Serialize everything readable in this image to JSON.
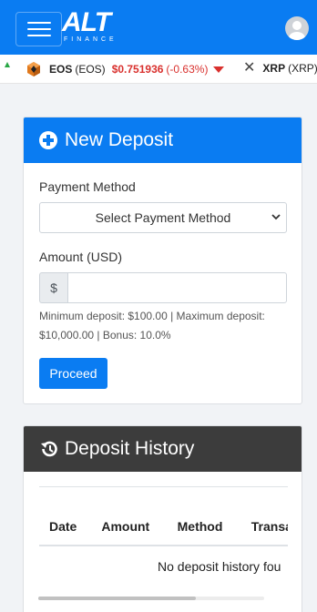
{
  "navbar": {
    "logo_text": "ALT",
    "logo_sub": "FINANCE"
  },
  "ticker": [
    {
      "name": "EOS",
      "symbol": "(EOS)",
      "price": "$0.751936",
      "change": "(-0.63%)",
      "direction": "down",
      "icon": "eos-coin-icon"
    },
    {
      "name": "XRP",
      "symbol": "(XRP)",
      "icon": "xrp-coin-icon"
    }
  ],
  "deposit": {
    "title": "New Deposit",
    "payment_label": "Payment Method",
    "payment_selected": "Select Payment Method",
    "amount_label": "Amount (USD)",
    "currency_addon": "$",
    "amount_value": "",
    "help_text": "Minimum deposit: $100.00 | Maximum deposit: $10,000.00 | Bonus: 10.0%",
    "proceed_label": "Proceed"
  },
  "history": {
    "title": "Deposit History",
    "columns": [
      "Date",
      "Amount",
      "Method",
      "Transact ID"
    ],
    "empty_text": "No deposit history fou"
  },
  "colors": {
    "primary": "#0a7cf2",
    "dark_header": "#3c3c3c",
    "negative": "#d9312e",
    "positive": "#28a745"
  }
}
